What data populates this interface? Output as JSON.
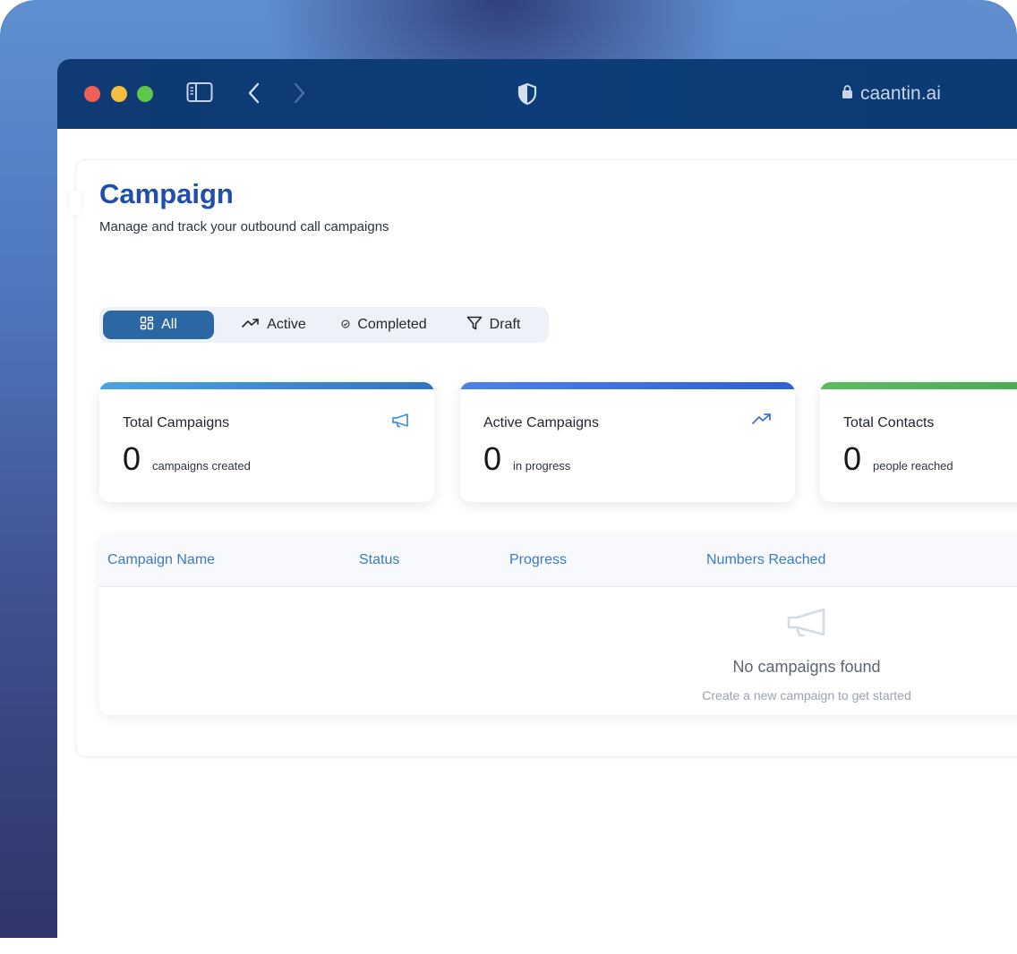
{
  "browser": {
    "url": "caantin.ai"
  },
  "page": {
    "title": "Campaign",
    "subtitle": "Manage and track your outbound call campaigns"
  },
  "filters": {
    "tabs": [
      {
        "label": "All",
        "icon": "grid-icon",
        "selected": true
      },
      {
        "label": "Active",
        "icon": "trending-up-icon",
        "selected": false
      },
      {
        "label": "Completed",
        "icon": "check-circle-icon",
        "selected": false
      },
      {
        "label": "Draft",
        "icon": "filter-icon",
        "selected": false
      }
    ]
  },
  "stats": [
    {
      "label": "Total Campaigns",
      "value": "0",
      "caption": "campaigns created",
      "icon": "megaphone-icon",
      "accent": "#3f8fd8"
    },
    {
      "label": "Active Campaigns",
      "value": "0",
      "caption": "in progress",
      "icon": "trending-up-icon",
      "accent": "#3f6fdd"
    },
    {
      "label": "Total Contacts",
      "value": "0",
      "caption": "people reached",
      "icon": "users-icon",
      "accent": "#4caf50"
    }
  ],
  "table": {
    "columns": [
      "Campaign Name",
      "Status",
      "Progress",
      "Numbers Reached"
    ],
    "empty": {
      "title": "No campaigns found",
      "subtitle": "Create a new campaign to get started"
    }
  }
}
